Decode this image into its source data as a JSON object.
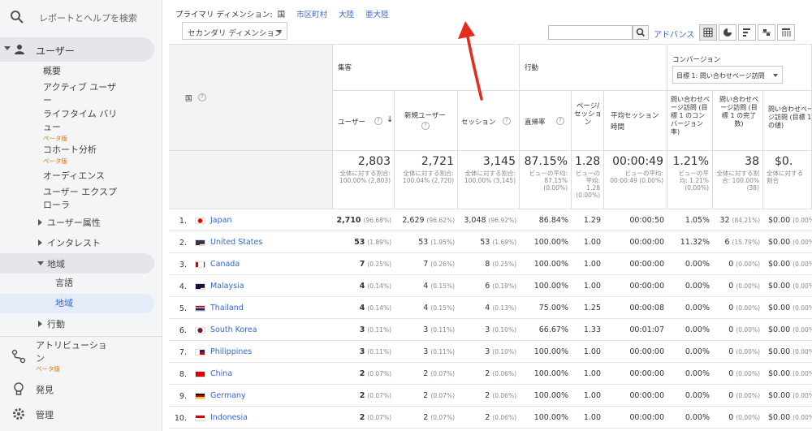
{
  "sidebar": {
    "search_label": "レポートとヘルプを検索",
    "users_label": "ユーザー",
    "items": [
      {
        "label": "概要"
      },
      {
        "label": "アクティブ ユーザー"
      },
      {
        "label": "ライフタイム バリュー"
      },
      {
        "label": "コホート分析"
      },
      {
        "label": "オーディエンス"
      },
      {
        "label": "ユーザー エクスプローラ"
      }
    ],
    "beta_label": "ベータ版",
    "groups": [
      {
        "label": "ユーザー属性"
      },
      {
        "label": "インタレスト"
      },
      {
        "label": "地域"
      },
      {
        "label": "行動"
      }
    ],
    "region_children": [
      {
        "label": "言語"
      },
      {
        "label": "地域"
      }
    ],
    "bottom": [
      {
        "label": "アトリビューション"
      },
      {
        "label": "発見"
      },
      {
        "label": "管理"
      }
    ]
  },
  "toolbar": {
    "primary_label": "プライマリ ディメンション:",
    "primary_current": "国",
    "primary_links": [
      "市区町村",
      "大陸",
      "亜大陸"
    ],
    "secondary_dim": "セカンダリ ディメンション",
    "advanced": "アドバンス"
  },
  "table": {
    "col_country": "国",
    "group_acquisition": "集客",
    "group_behavior": "行動",
    "group_conversion": "コンバージョン",
    "goal_select": "目標 1: 問い合わせページ訪問",
    "cols": {
      "users": "ユーザー",
      "new_users": "新規ユーザー",
      "sessions": "セッション",
      "bounce": "直帰率",
      "pages_per_session": "ページ/セッション",
      "avg_duration": "平均セッション時間",
      "conv_rate": "問い合わせページ訪問 (目標 1 のコンバージョン率)",
      "completions": "問い合わせページ訪問 (目標 1 の完了数)",
      "value": "問い合わせページ訪問 (目標 1 の値)"
    },
    "totals": {
      "users": "2,803",
      "users_sub": "全体に対する割合: 100.00% (2,803)",
      "new_users": "2,721",
      "new_users_sub": "全体に対する割合: 100.04% (2,720)",
      "sessions": "3,145",
      "sessions_sub": "全体に対する割合: 100.00% (3,145)",
      "bounce": "87.15%",
      "bounce_sub": "ビューの平均: 87.15% (0.00%)",
      "pps": "1.28",
      "pps_sub": "ビューの平均: 1.28 (0.00%)",
      "dur": "00:00:49",
      "dur_sub": "ビューの平均: 00:00:49 (0.00%)",
      "conv": "1.21%",
      "conv_sub": "ビューの平均: 1.21% (0.00%)",
      "comp": "38",
      "comp_sub": "全体に対する割合: 100.00% (38)",
      "val": "$0.",
      "val_sub": "全体に対する割合"
    },
    "rows": [
      {
        "num": "1.",
        "country": "Japan",
        "users": "2,710",
        "users_pct": "(96.68%)",
        "new": "2,629",
        "new_pct": "(96.62%)",
        "sess": "3,048",
        "sess_pct": "(96.92%)",
        "bounce": "86.84%",
        "pps": "1.29",
        "dur": "00:00:50",
        "conv": "1.05%",
        "comp": "32",
        "comp_pct": "(84.21%)",
        "val": "$0.00",
        "val_pct": "(0.00%)"
      },
      {
        "num": "2.",
        "country": "United States",
        "users": "53",
        "users_pct": "(1.89%)",
        "new": "53",
        "new_pct": "(1.95%)",
        "sess": "53",
        "sess_pct": "(1.69%)",
        "bounce": "100.00%",
        "pps": "1.00",
        "dur": "00:00:00",
        "conv": "11.32%",
        "comp": "6",
        "comp_pct": "(15.79%)",
        "val": "$0.00",
        "val_pct": "(0.00%)"
      },
      {
        "num": "3.",
        "country": "Canada",
        "users": "7",
        "users_pct": "(0.25%)",
        "new": "7",
        "new_pct": "(0.26%)",
        "sess": "8",
        "sess_pct": "(0.25%)",
        "bounce": "100.00%",
        "pps": "1.00",
        "dur": "00:00:00",
        "conv": "0.00%",
        "comp": "0",
        "comp_pct": "(0.00%)",
        "val": "$0.00",
        "val_pct": "(0.00%)"
      },
      {
        "num": "4.",
        "country": "Malaysia",
        "users": "4",
        "users_pct": "(0.14%)",
        "new": "4",
        "new_pct": "(0.15%)",
        "sess": "6",
        "sess_pct": "(0.19%)",
        "bounce": "100.00%",
        "pps": "1.00",
        "dur": "00:00:00",
        "conv": "0.00%",
        "comp": "0",
        "comp_pct": "(0.00%)",
        "val": "$0.00",
        "val_pct": "(0.00%)"
      },
      {
        "num": "5.",
        "country": "Thailand",
        "users": "4",
        "users_pct": "(0.14%)",
        "new": "4",
        "new_pct": "(0.15%)",
        "sess": "4",
        "sess_pct": "(0.13%)",
        "bounce": "75.00%",
        "pps": "1.25",
        "dur": "00:00:08",
        "conv": "0.00%",
        "comp": "0",
        "comp_pct": "(0.00%)",
        "val": "$0.00",
        "val_pct": "(0.00%)"
      },
      {
        "num": "6.",
        "country": "South Korea",
        "users": "3",
        "users_pct": "(0.11%)",
        "new": "3",
        "new_pct": "(0.11%)",
        "sess": "3",
        "sess_pct": "(0.10%)",
        "bounce": "66.67%",
        "pps": "1.33",
        "dur": "00:01:07",
        "conv": "0.00%",
        "comp": "0",
        "comp_pct": "(0.00%)",
        "val": "$0.00",
        "val_pct": "(0.00%)"
      },
      {
        "num": "7.",
        "country": "Philippines",
        "users": "3",
        "users_pct": "(0.11%)",
        "new": "3",
        "new_pct": "(0.11%)",
        "sess": "3",
        "sess_pct": "(0.10%)",
        "bounce": "100.00%",
        "pps": "1.00",
        "dur": "00:00:00",
        "conv": "0.00%",
        "comp": "0",
        "comp_pct": "(0.00%)",
        "val": "$0.00",
        "val_pct": "(0.00%)"
      },
      {
        "num": "8.",
        "country": "China",
        "users": "2",
        "users_pct": "(0.07%)",
        "new": "2",
        "new_pct": "(0.07%)",
        "sess": "2",
        "sess_pct": "(0.06%)",
        "bounce": "100.00%",
        "pps": "1.00",
        "dur": "00:00:00",
        "conv": "0.00%",
        "comp": "0",
        "comp_pct": "(0.00%)",
        "val": "$0.00",
        "val_pct": "(0.00%)"
      },
      {
        "num": "9.",
        "country": "Germany",
        "users": "2",
        "users_pct": "(0.07%)",
        "new": "2",
        "new_pct": "(0.07%)",
        "sess": "2",
        "sess_pct": "(0.06%)",
        "bounce": "100.00%",
        "pps": "1.00",
        "dur": "00:00:00",
        "conv": "0.00%",
        "comp": "0",
        "comp_pct": "(0.00%)",
        "val": "$0.00",
        "val_pct": "(0.00%)"
      },
      {
        "num": "10.",
        "country": "Indonesia",
        "users": "2",
        "users_pct": "(0.07%)",
        "new": "2",
        "new_pct": "(0.07%)",
        "sess": "2",
        "sess_pct": "(0.06%)",
        "bounce": "100.00%",
        "pps": "1.00",
        "dur": "00:00:00",
        "conv": "0.00%",
        "comp": "0",
        "comp_pct": "(0.00%)",
        "val": "$0.00",
        "val_pct": "(0.00%)"
      }
    ]
  },
  "flags": [
    "japan-flag-icon",
    "us-flag-icon",
    "canada-flag-icon",
    "malaysia-flag-icon",
    "thailand-flag-icon",
    "south-korea-flag-icon",
    "philippines-flag-icon",
    "china-flag-icon",
    "germany-flag-icon",
    "indonesia-flag-icon"
  ],
  "colors": {
    "link": "#3367d6",
    "beta": "#e8710a",
    "arrow": "#e52b1e",
    "sidebar_bg": "#f4f5f7"
  }
}
